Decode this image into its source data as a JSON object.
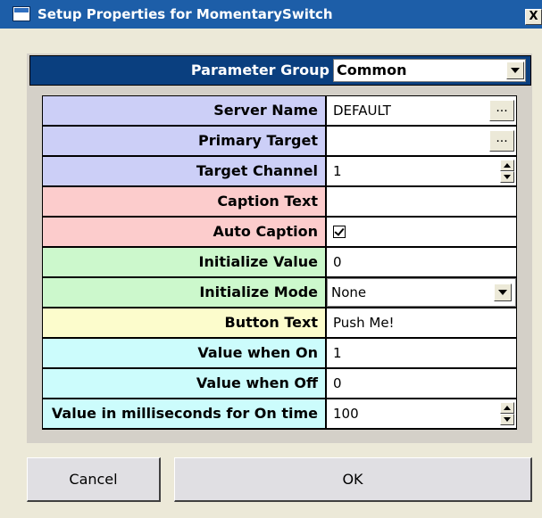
{
  "window": {
    "title": "Setup Properties for MomentarySwitch",
    "close_label": "X"
  },
  "parameter_group": {
    "label": "Parameter Group",
    "selected": "Common"
  },
  "rows": [
    {
      "label": "Server Name",
      "value": "DEFAULT",
      "button": "..."
    },
    {
      "label": "Primary Target",
      "value": "",
      "button": "..."
    },
    {
      "label": "Target Channel",
      "value": "1"
    },
    {
      "label": "Caption Text",
      "value": ""
    },
    {
      "label": "Auto Caption",
      "checked": true
    },
    {
      "label": "Initialize Value",
      "value": "0"
    },
    {
      "label": "Initialize Mode",
      "value": "None"
    },
    {
      "label": "Button Text",
      "value": "Push Me!"
    },
    {
      "label": "Value when On",
      "value": "1"
    },
    {
      "label": "Value when Off",
      "value": "0"
    },
    {
      "label": "Value in milliseconds for On time",
      "value": "100"
    }
  ],
  "buttons": {
    "cancel": "Cancel",
    "ok": "OK"
  },
  "colors": {
    "title_bar": "#1d5ea8",
    "parameter_group_header": "#0a3f7f",
    "group_blue": "#cccff7",
    "group_red": "#fccccc",
    "group_green": "#ccf8cc",
    "group_yellow": "#fcfccc",
    "group_cyan": "#ccfcfc"
  }
}
